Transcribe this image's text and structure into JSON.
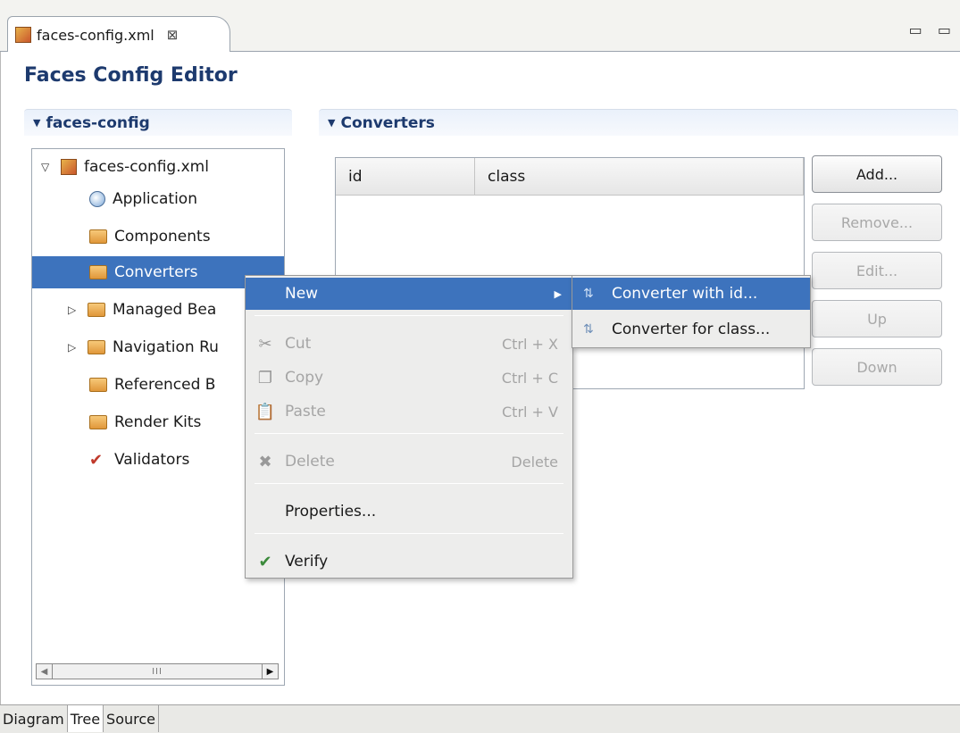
{
  "editor_tab": {
    "title": "faces-config.xml",
    "close": "⊠"
  },
  "window_controls": "▭ ▭",
  "editor_title": "Faces Config Editor",
  "left_section": {
    "title": "faces-config"
  },
  "tree": {
    "root": "faces-config.xml",
    "items": [
      {
        "label": "Application"
      },
      {
        "label": "Components"
      },
      {
        "label": "Converters"
      },
      {
        "label": "Managed Bea"
      },
      {
        "label": "Navigation Ru"
      },
      {
        "label": "Referenced B"
      },
      {
        "label": "Render Kits"
      },
      {
        "label": "Validators"
      }
    ],
    "scroll_thumb": "III"
  },
  "right_section": {
    "title": "Converters"
  },
  "table": {
    "columns": [
      "id",
      "class"
    ]
  },
  "buttons": {
    "add": "Add...",
    "remove": "Remove...",
    "edit": "Edit...",
    "up": "Up",
    "down": "Down"
  },
  "context_menu": {
    "new": "New",
    "cut": {
      "label": "Cut",
      "shortcut": "Ctrl + X"
    },
    "copy": {
      "label": "Copy",
      "shortcut": "Ctrl + C"
    },
    "paste": {
      "label": "Paste",
      "shortcut": "Ctrl + V"
    },
    "delete": {
      "label": "Delete",
      "shortcut": "Delete"
    },
    "properties": "Properties...",
    "verify": "Verify"
  },
  "submenu": {
    "with_id": "Converter with id...",
    "for_class": "Converter for class..."
  },
  "bottom_tabs": [
    "Diagram",
    "Tree",
    "Source"
  ],
  "colors": {
    "selection": "#3d73bd",
    "heading": "#1d3a6e"
  }
}
